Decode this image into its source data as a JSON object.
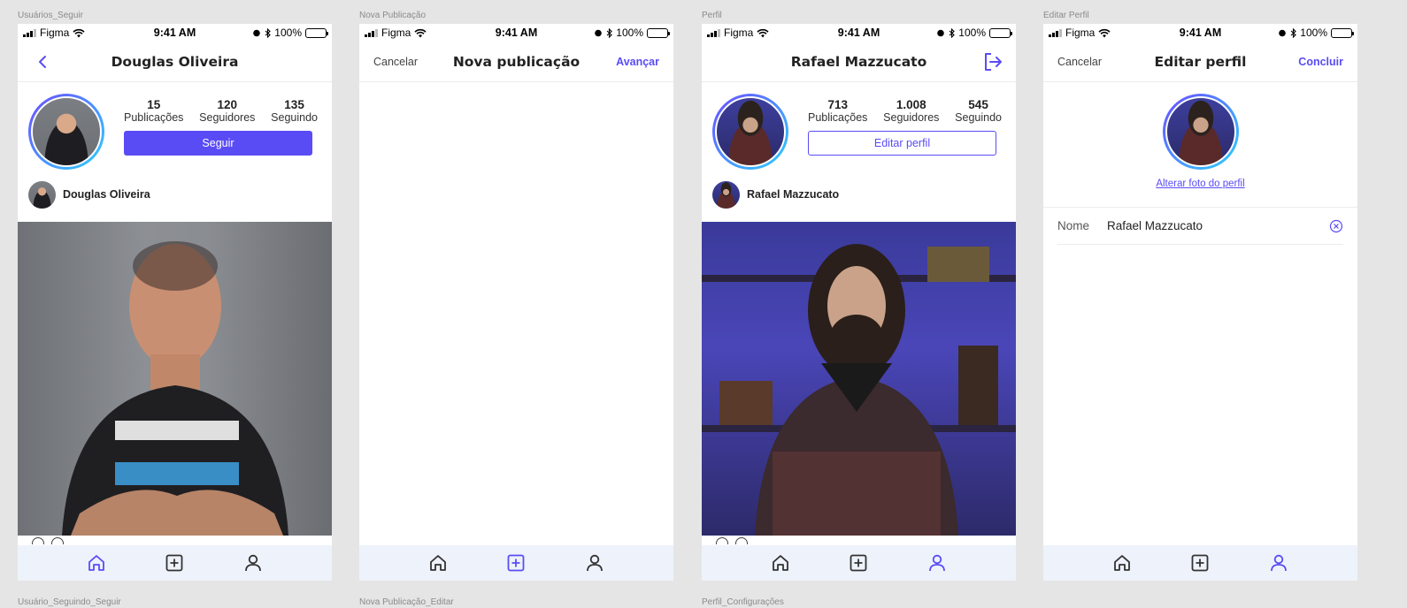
{
  "frames": [
    {
      "label": "Usuários_Seguir",
      "bottom_label": "Usuário_Seguindo_Seguir"
    },
    {
      "label": "Nova Publicação",
      "bottom_label": "Nova Publicação_Editar"
    },
    {
      "label": "Perfil",
      "bottom_label": "Perfil_Configurações"
    },
    {
      "label": "Editar Perfil"
    }
  ],
  "statusbar": {
    "carrier": "Figma",
    "time": "9:41 AM",
    "battery": "100%"
  },
  "user_follow": {
    "title": "Douglas Oliveira",
    "stats": [
      {
        "num": "15",
        "label": "Publicações"
      },
      {
        "num": "120",
        "label": "Seguidores"
      },
      {
        "num": "135",
        "label": "Seguindo"
      }
    ],
    "follow_button": "Seguir",
    "post_author": "Douglas Oliveira"
  },
  "new_post": {
    "cancel": "Cancelar",
    "title": "Nova publicação",
    "next": "Avançar"
  },
  "profile": {
    "title": "Rafael Mazzucato",
    "stats": [
      {
        "num": "713",
        "label": "Publicações"
      },
      {
        "num": "1.008",
        "label": "Seguidores"
      },
      {
        "num": "545",
        "label": "Seguindo"
      }
    ],
    "edit_button": "Editar perfil",
    "post_author": "Rafael Mazzucato"
  },
  "edit_profile": {
    "cancel": "Cancelar",
    "title": "Editar perfil",
    "done": "Concluir",
    "change_photo": "Alterar foto do perfil",
    "name_label": "Nome",
    "name_value": "Rafael Mazzucato"
  },
  "colors": {
    "accent": "#5a4cf5",
    "tabbar_bg": "#eef2fb"
  },
  "tabbar_icons": [
    "home-icon",
    "plus-square-icon",
    "user-icon"
  ],
  "active_tabs": [
    "home",
    "add",
    "profile",
    "profile"
  ]
}
